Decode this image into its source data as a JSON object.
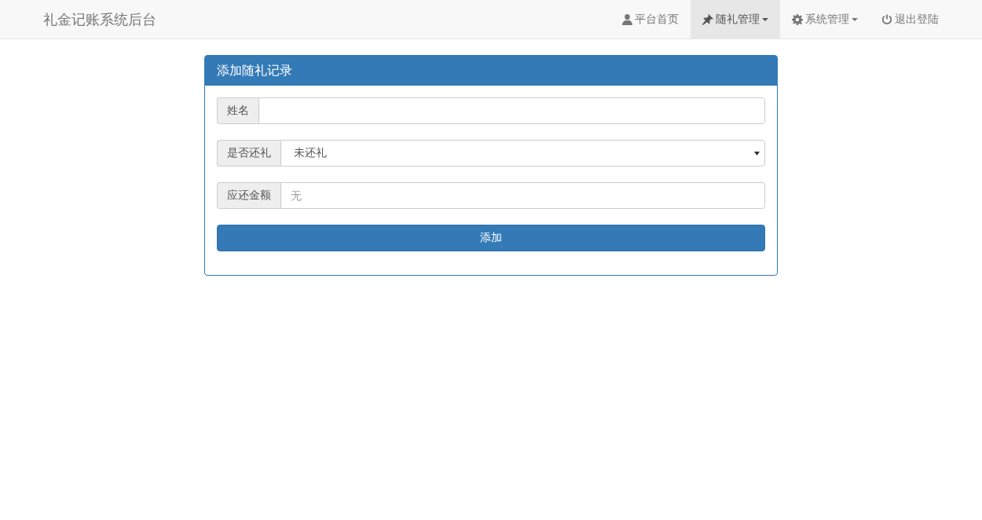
{
  "navbar": {
    "brand": "礼金记账系统后台",
    "items": [
      {
        "label": "平台首页",
        "dropdown": false,
        "selected": false
      },
      {
        "label": "随礼管理",
        "dropdown": true,
        "selected": true
      },
      {
        "label": "系统管理",
        "dropdown": true,
        "selected": false
      },
      {
        "label": "退出登陆",
        "dropdown": false,
        "selected": false
      }
    ]
  },
  "panel": {
    "title": "添加随礼记录",
    "fields": [
      {
        "kind": "input",
        "label": "姓名"
      },
      {
        "kind": "select",
        "label": "是否还礼",
        "value": "未还礼"
      },
      {
        "kind": "input",
        "label": "应还金额",
        "placeholder": "无"
      }
    ],
    "button": "添加"
  }
}
